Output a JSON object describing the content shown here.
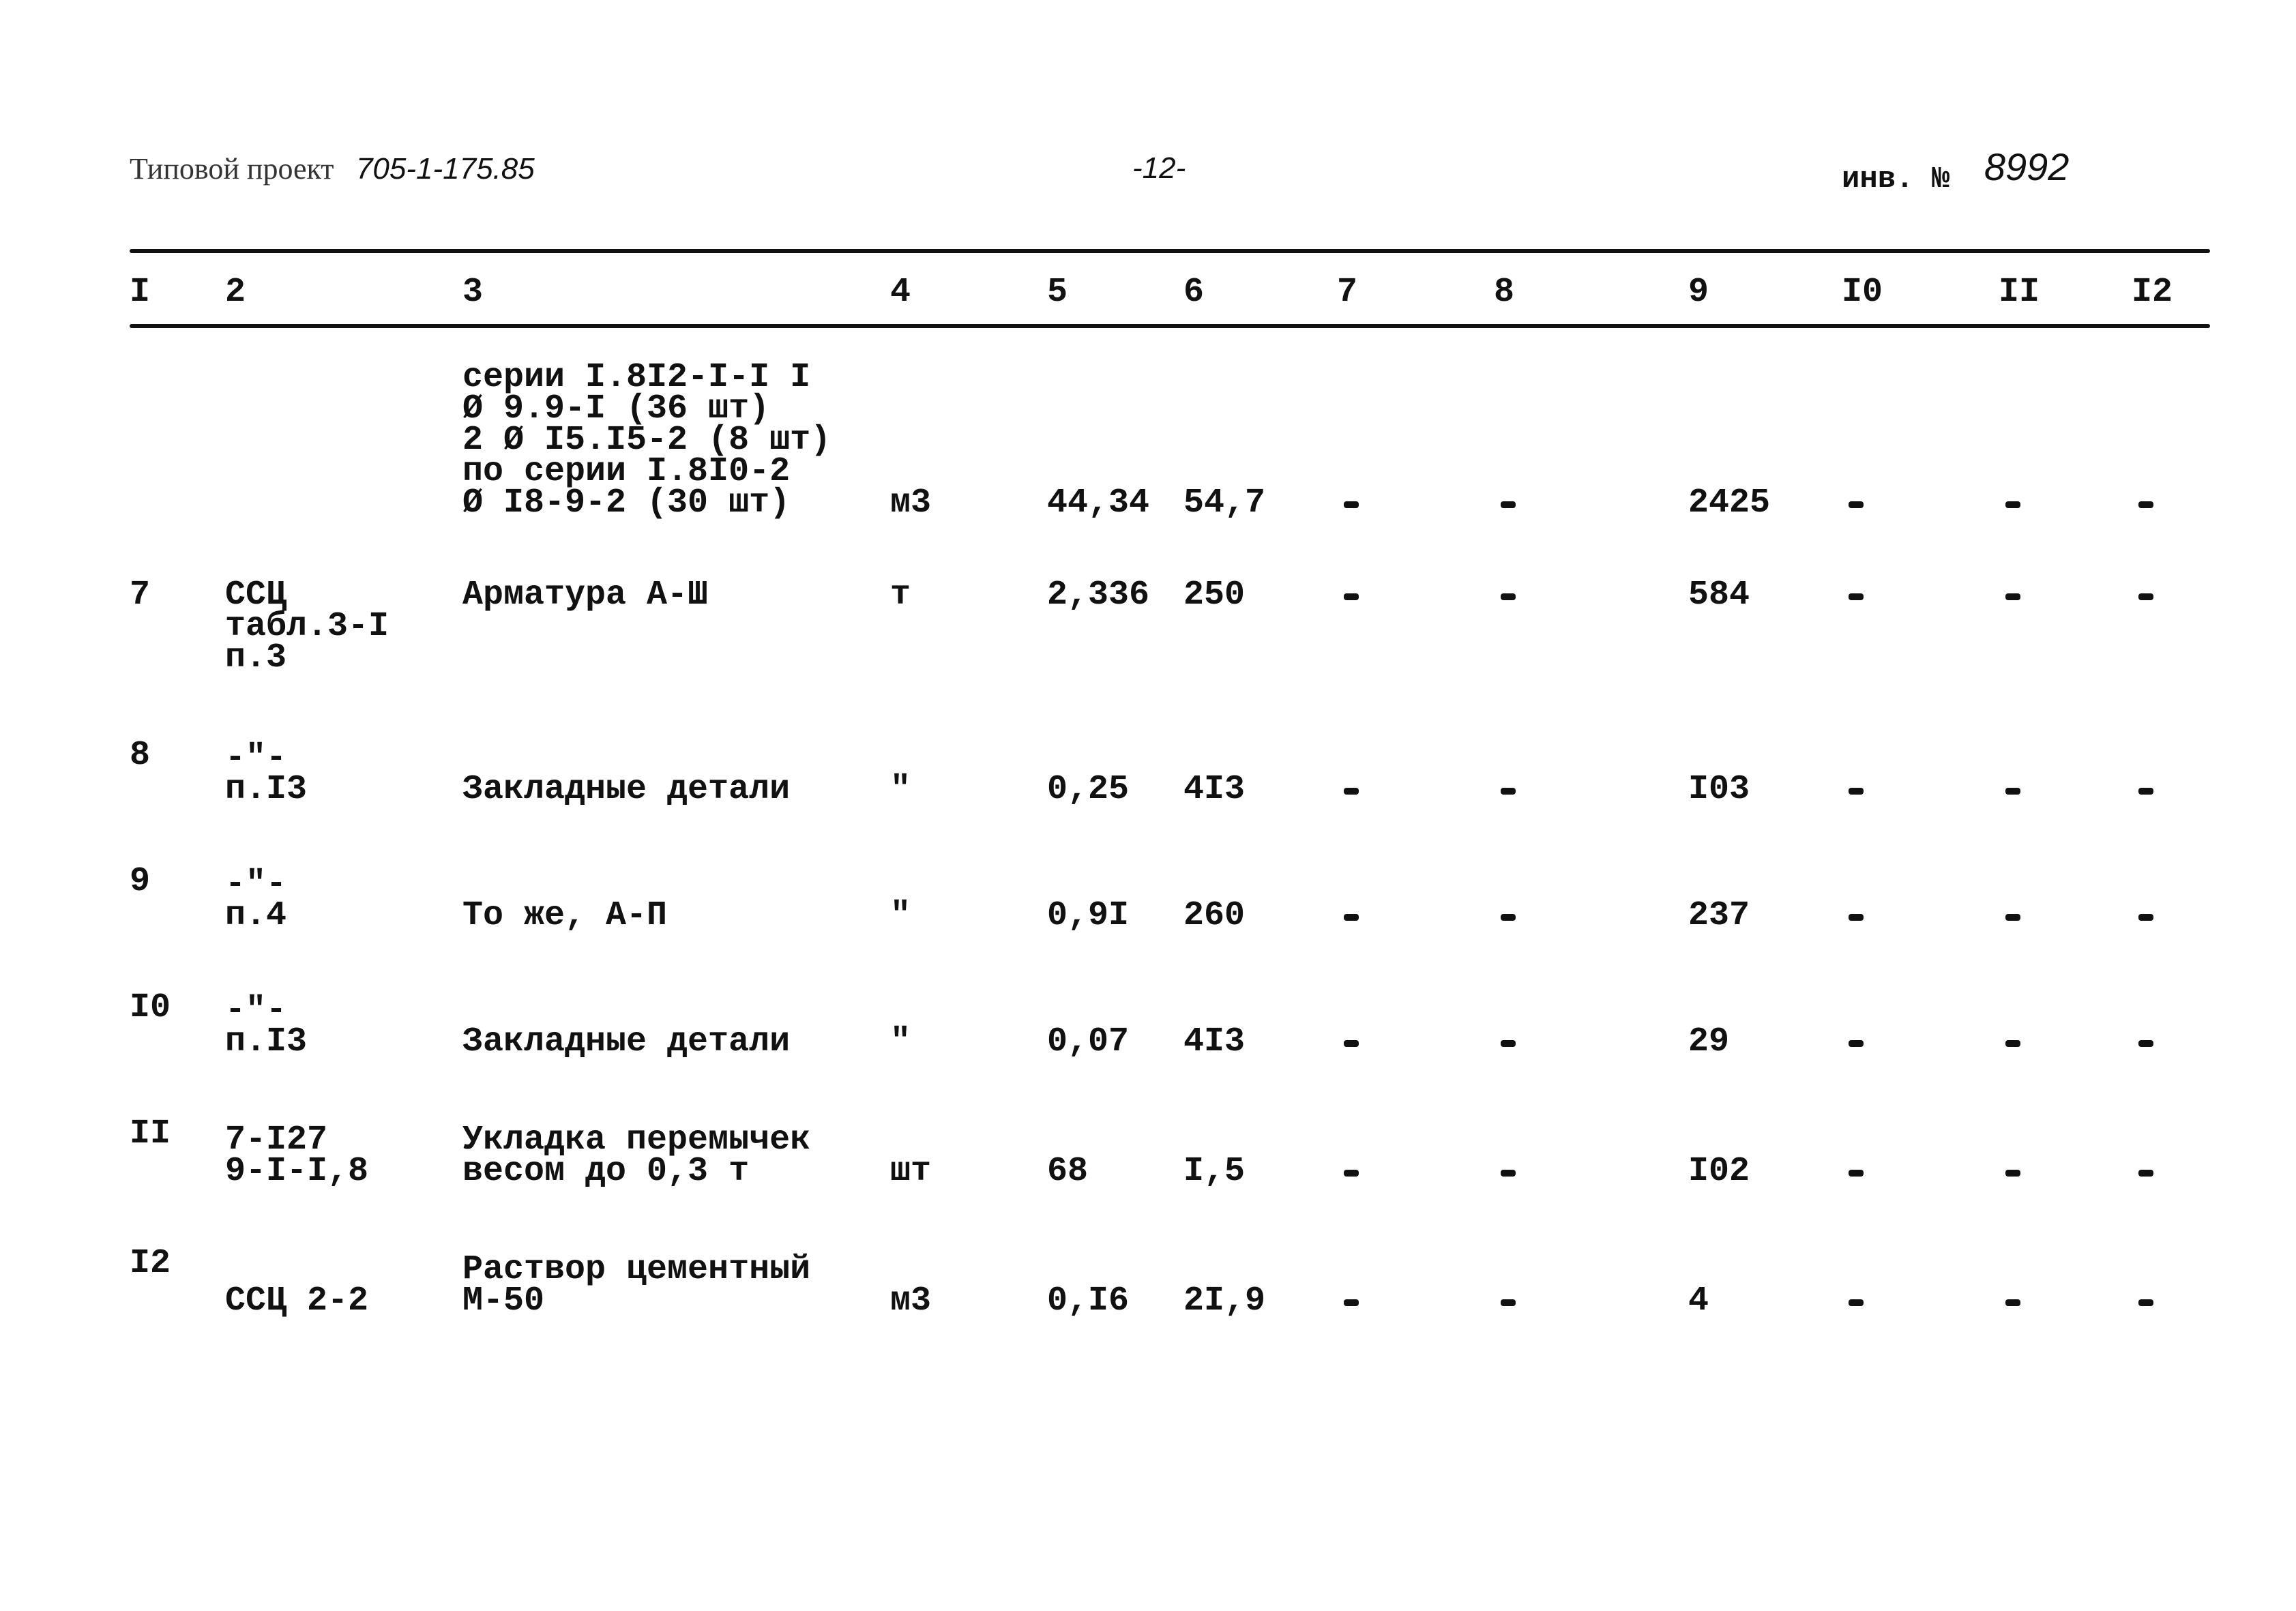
{
  "header": {
    "left_typed": "Типовой проект",
    "left_code": "705-1-175.85",
    "page_number": "-12-",
    "inv_label": "инв. №",
    "inv_number": "8992"
  },
  "columns": [
    "I",
    "2",
    "3",
    "4",
    "5",
    "6",
    "7",
    "8",
    "9",
    "I0",
    "II",
    "I2"
  ],
  "rows": [
    {
      "num": "",
      "ref": "",
      "name": "серии I.8I2-I-I I\nØ 9.9-I (36 шт)\n2 Ø I5.I5-2 (8 шт)\nпо серии I.8I0-2\nØ I8-9-2 (30 шт)",
      "unit": "м3",
      "qty": "44,34",
      "price": "54,7",
      "c7": "-",
      "c8": "-",
      "c9": "2425",
      "c10": "-",
      "c11": "-",
      "c12": "-"
    },
    {
      "num": "7",
      "ref": "ССЦ\nтабл.3-I\nп.3",
      "name": "Арматура А-Ш",
      "unit": "т",
      "qty": "2,336",
      "price": "250",
      "c7": "-",
      "c8": "-",
      "c9": "584",
      "c10": "-",
      "c11": "-",
      "c12": "-"
    },
    {
      "num": "8",
      "ref": "-\"-\nп.I3",
      "name": "Закладные детали",
      "unit": "\"",
      "qty": "0,25",
      "price": "4I3",
      "c7": "-",
      "c8": "-",
      "c9": "I03",
      "c10": "-",
      "c11": "-",
      "c12": "-"
    },
    {
      "num": "9",
      "ref": "-\"-\nп.4",
      "name": "То же, А-П",
      "unit": "\"",
      "qty": "0,9I",
      "price": "260",
      "c7": "-",
      "c8": "-",
      "c9": "237",
      "c10": "-",
      "c11": "-",
      "c12": "-"
    },
    {
      "num": "I0",
      "ref": "-\"-\nп.I3",
      "name": "Закладные детали",
      "unit": "\"",
      "qty": "0,07",
      "price": "4I3",
      "c7": "-",
      "c8": "-",
      "c9": "29",
      "c10": "-",
      "c11": "-",
      "c12": "-"
    },
    {
      "num": "II",
      "ref": "7-I27\n9-I-I,8",
      "name": "Укладка перемычек\nвесом до 0,3 т",
      "unit": "шт",
      "qty": "68",
      "price": "I,5",
      "c7": "-",
      "c8": "-",
      "c9": "I02",
      "c10": "-",
      "c11": "-",
      "c12": "-"
    },
    {
      "num": "I2",
      "ref": "ССЦ 2-2",
      "name": "Раствор цементный\nМ-50",
      "unit": "м3",
      "qty": "0,I6",
      "price": "2I,9",
      "c7": "-",
      "c8": "-",
      "c9": "4",
      "c10": "-",
      "c11": "-",
      "c12": "-"
    }
  ]
}
